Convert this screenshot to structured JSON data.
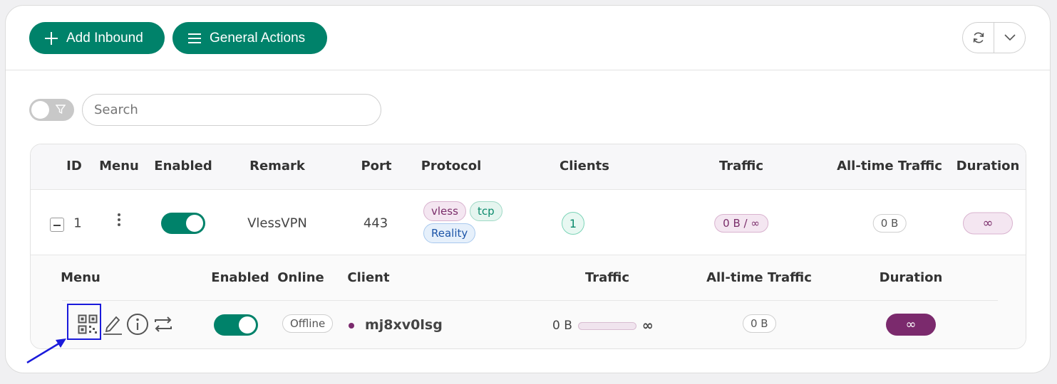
{
  "toolbar": {
    "add_label": "Add Inbound",
    "general_label": "General Actions"
  },
  "filter": {
    "search_placeholder": "Search"
  },
  "table": {
    "headers": {
      "id": "ID",
      "menu": "Menu",
      "enabled": "Enabled",
      "remark": "Remark",
      "port": "Port",
      "protocol": "Protocol",
      "clients": "Clients",
      "traffic": "Traffic",
      "alltime": "All-time Traffic",
      "duration": "Duration"
    },
    "row": {
      "id": "1",
      "remark": "VlessVPN",
      "port": "443",
      "protocol_tags": [
        "vless",
        "tcp",
        "Reality"
      ],
      "clients": "1",
      "traffic": "0 B / ∞",
      "alltime": "0 B",
      "duration": "∞"
    }
  },
  "clients_table": {
    "headers": {
      "menu": "Menu",
      "enabled": "Enabled",
      "online": "Online",
      "client": "Client",
      "traffic": "Traffic",
      "alltime": "All-time Traffic",
      "duration": "Duration"
    },
    "row": {
      "online": "Offline",
      "client": "mj8xv0lsg",
      "traffic_used": "0 B",
      "traffic_limit": "∞",
      "traffic_fraction": 0,
      "alltime": "0 B",
      "duration": "∞"
    }
  },
  "colors": {
    "primary": "#00826a",
    "accent_purple": "#7b2a6d",
    "highlight_blue": "#1a1adb"
  }
}
